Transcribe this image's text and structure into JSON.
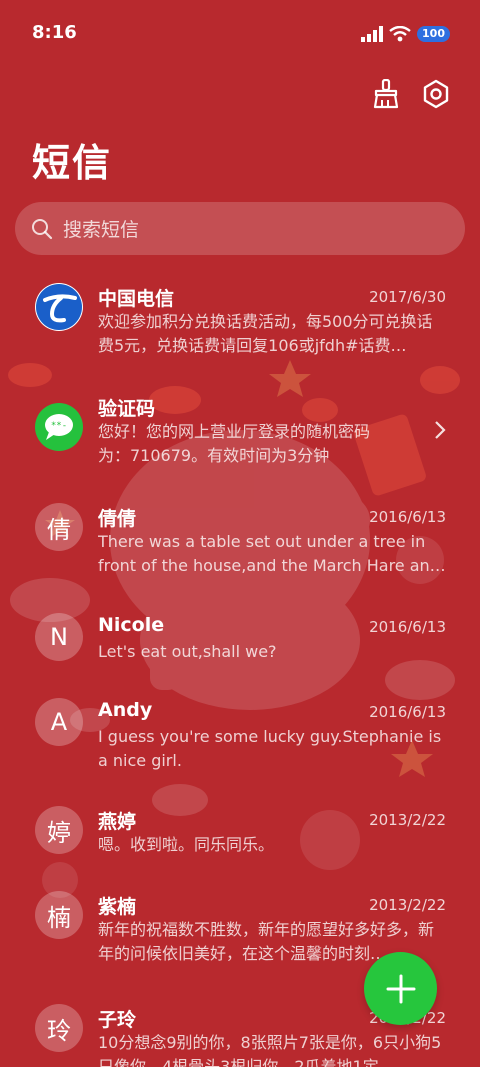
{
  "status_bar": {
    "time": "8:16",
    "battery": "100"
  },
  "toolbar": {
    "clean_icon": "broom-icon",
    "settings_icon": "settings-icon"
  },
  "page_title": "短信",
  "search": {
    "placeholder": "搜索短信"
  },
  "messages": [
    {
      "name": "中国电信",
      "date": "2017/6/30",
      "avatar_type": "logo",
      "preview": "欢迎参加积分兑换话费活动，每500分可兑换话费5元，兑换话费请回复106或jfdh#话费…"
    },
    {
      "name": "验证码",
      "date": "",
      "avatar_type": "message-icon",
      "preview": "您好！您的网上营业厅登录的随机密码为：710679。有效时间为3分钟"
    },
    {
      "name": "倩倩",
      "avatar_text": "倩",
      "date": "2016/6/13",
      "preview": "There was a table set out under a tree in front of the house,and the March Hare an…"
    },
    {
      "name": "Nicole",
      "avatar_text": "N",
      "date": "2016/6/13",
      "preview": "Let's eat out,shall we?"
    },
    {
      "name": "Andy",
      "avatar_text": "A",
      "date": "2016/6/13",
      "preview": "I guess you're some lucky guy.Stephanie is a nice girl."
    },
    {
      "name": "燕婷",
      "avatar_text": "婷",
      "date": "2013/2/22",
      "preview": "嗯。收到啦。同乐同乐。"
    },
    {
      "name": "紫楠",
      "avatar_text": "楠",
      "date": "2013/2/22",
      "preview": "新年的祝福数不胜数，新年的愿望好多好多，新年的问候依旧美好，在这个温馨的时刻…"
    },
    {
      "name": "子玲",
      "avatar_text": "玲",
      "date": "2013/2/22",
      "preview": "10分想念9别的你，8张照片7张是你，6只小狗5只像你，4根骨头3根归你，2瓜着地1定…"
    }
  ],
  "fab": {
    "icon": "plus-icon"
  },
  "colors": {
    "background": "#b8292e",
    "fab": "#26c63d",
    "telecom_blue": "#1a5fc9"
  }
}
